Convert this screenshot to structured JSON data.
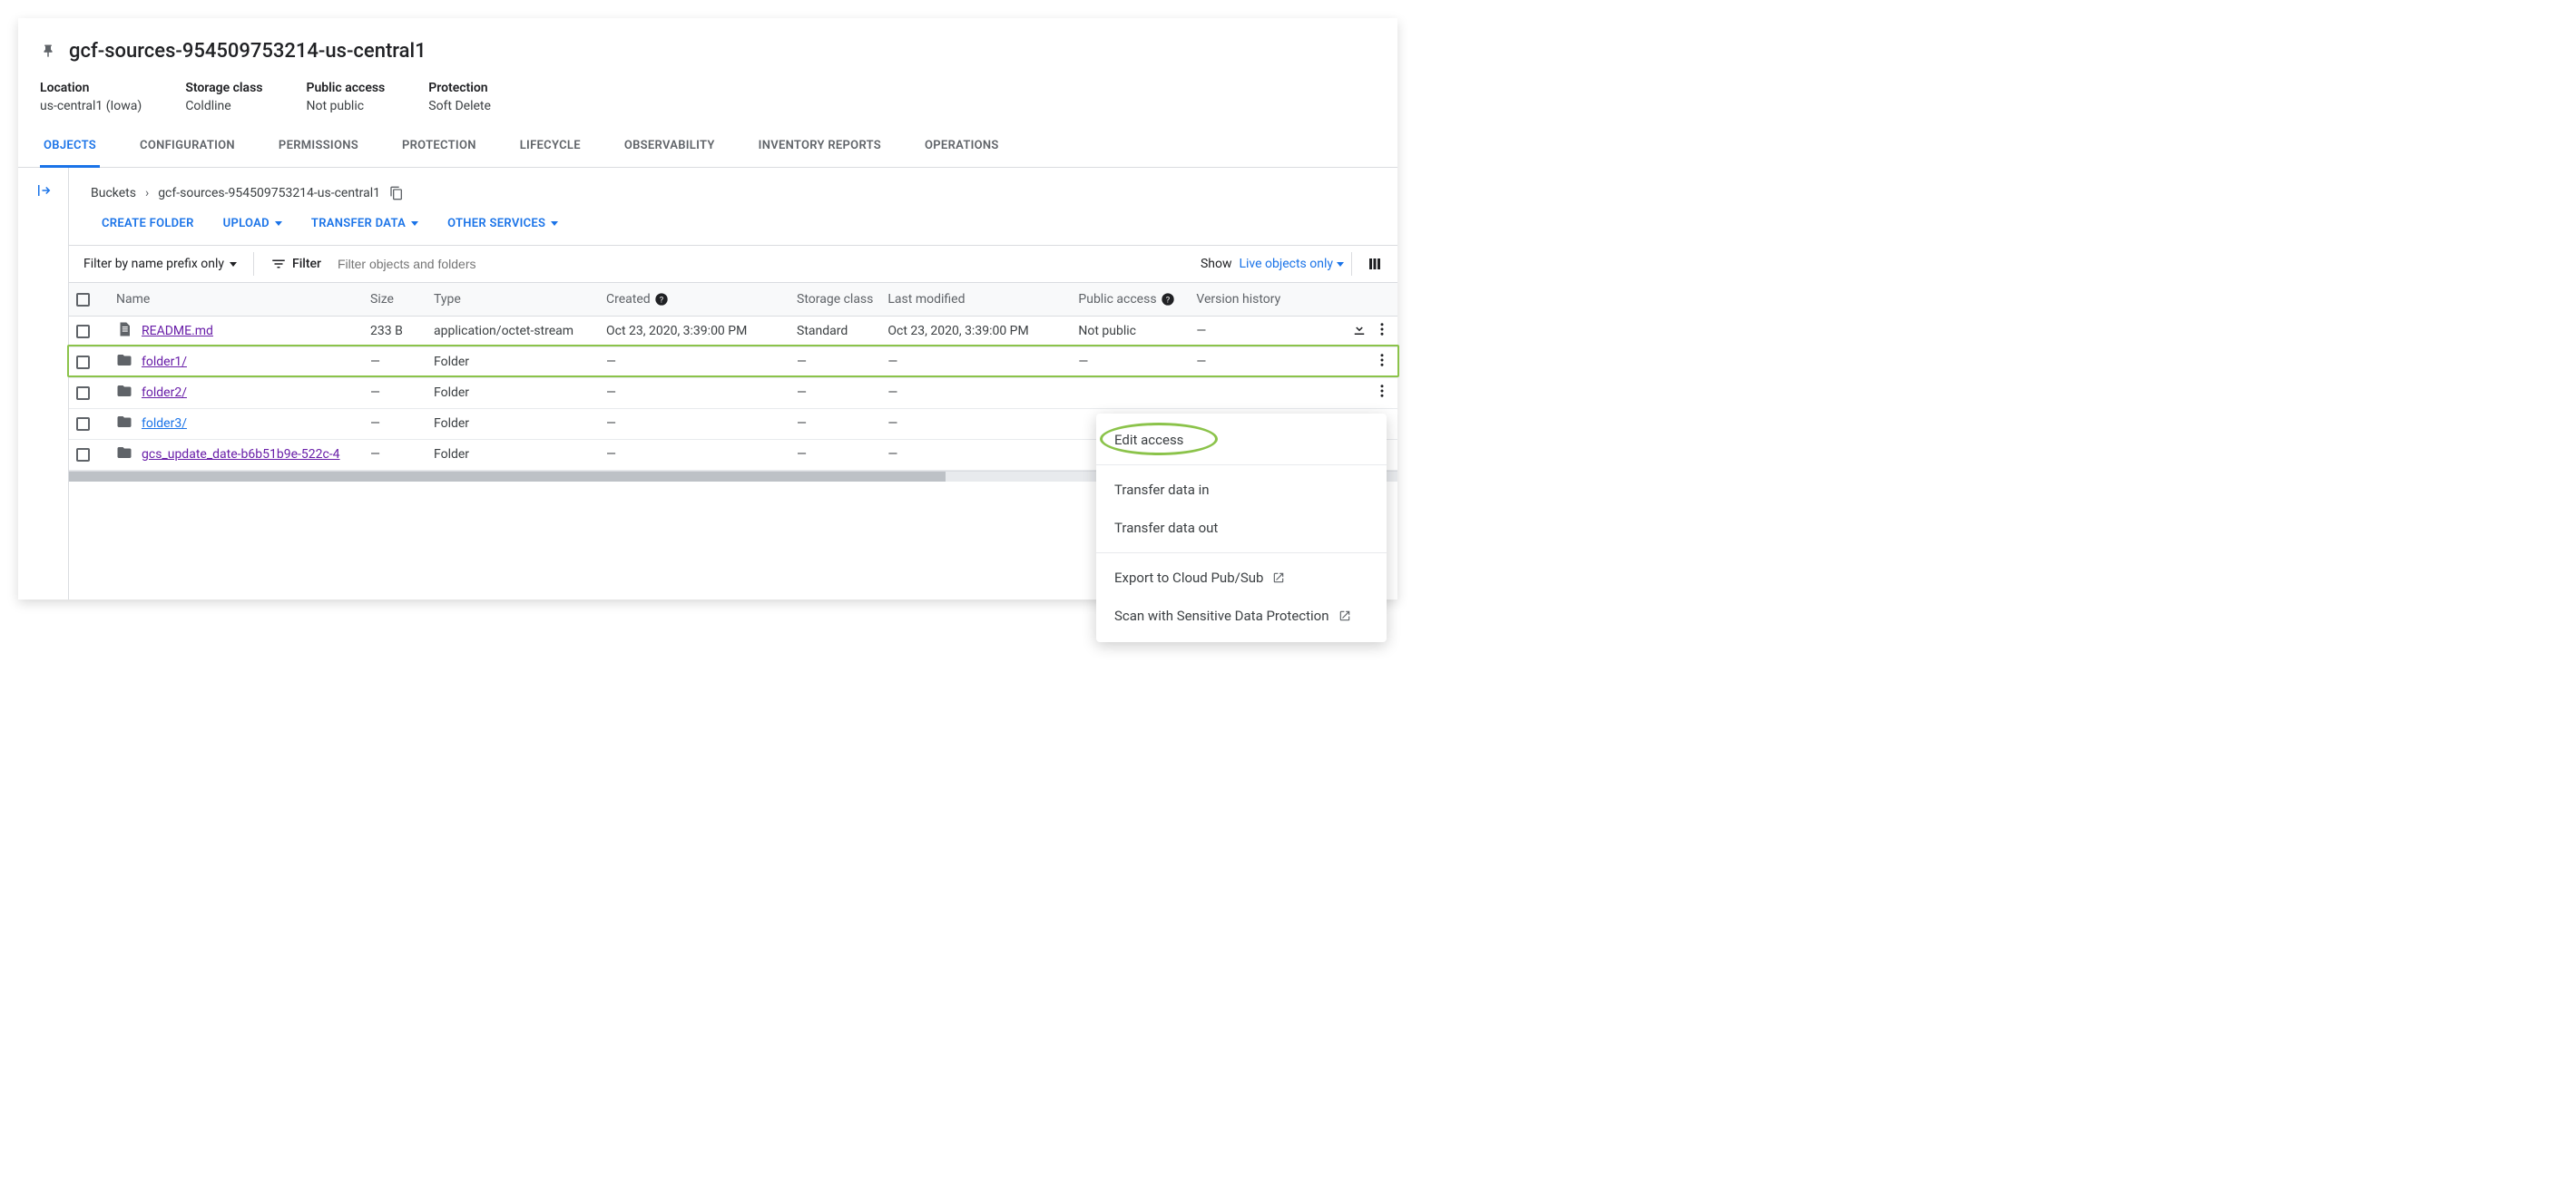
{
  "header": {
    "bucket_name": "gcf-sources-954509753214-us-central1"
  },
  "meta": [
    {
      "label": "Location",
      "value": "us-central1 (Iowa)"
    },
    {
      "label": "Storage class",
      "value": "Coldline"
    },
    {
      "label": "Public access",
      "value": "Not public"
    },
    {
      "label": "Protection",
      "value": "Soft Delete"
    }
  ],
  "tabs": [
    {
      "label": "OBJECTS",
      "active": true
    },
    {
      "label": "CONFIGURATION"
    },
    {
      "label": "PERMISSIONS"
    },
    {
      "label": "PROTECTION"
    },
    {
      "label": "LIFECYCLE"
    },
    {
      "label": "OBSERVABILITY"
    },
    {
      "label": "INVENTORY REPORTS"
    },
    {
      "label": "OPERATIONS"
    }
  ],
  "breadcrumbs": {
    "root": "Buckets",
    "current": "gcf-sources-954509753214-us-central1"
  },
  "actions": {
    "create_folder": "CREATE FOLDER",
    "upload": "UPLOAD",
    "transfer_data": "TRANSFER DATA",
    "other_services": "OTHER SERVICES"
  },
  "filter": {
    "prefix_label": "Filter by name prefix only",
    "filter_label": "Filter",
    "placeholder": "Filter objects and folders",
    "show_label": "Show",
    "show_value": "Live objects only"
  },
  "columns": [
    "Name",
    "Size",
    "Type",
    "Created",
    "Storage class",
    "Last modified",
    "Public access",
    "Version history"
  ],
  "rows": [
    {
      "icon": "file",
      "name": "README.md",
      "link_color": "purple",
      "size": "233 B",
      "type": "application/octet-stream",
      "created": "Oct 23, 2020, 3:39:00 PM",
      "storage_class": "Standard",
      "last_modified": "Oct 23, 2020, 3:39:00 PM",
      "public_access": "Not public",
      "version": "—",
      "download": true
    },
    {
      "icon": "folder",
      "name": "folder1/",
      "link_color": "purple",
      "size": "—",
      "type": "Folder",
      "created": "—",
      "storage_class": "—",
      "last_modified": "—",
      "public_access": "—",
      "version": "—",
      "highlight": true
    },
    {
      "icon": "folder",
      "name": "folder2/",
      "link_color": "purple",
      "size": "—",
      "type": "Folder",
      "created": "—",
      "storage_class": "—",
      "last_modified": "—",
      "public_access": "",
      "version": ""
    },
    {
      "icon": "folder",
      "name": "folder3/",
      "link_color": "blue",
      "size": "—",
      "type": "Folder",
      "created": "—",
      "storage_class": "—",
      "last_modified": "—",
      "public_access": "",
      "version": ""
    },
    {
      "icon": "folder",
      "name": "gcs_update_date-b6b51b9e-522c-4",
      "link_color": "purple",
      "size": "—",
      "type": "Folder",
      "created": "—",
      "storage_class": "—",
      "last_modified": "—",
      "public_access": "",
      "version": ""
    }
  ],
  "context_menu": {
    "edit_access": "Edit access",
    "transfer_in": "Transfer data in",
    "transfer_out": "Transfer data out",
    "export_pubsub": "Export to Cloud Pub/Sub",
    "scan_sdp": "Scan with Sensitive Data Protection"
  }
}
